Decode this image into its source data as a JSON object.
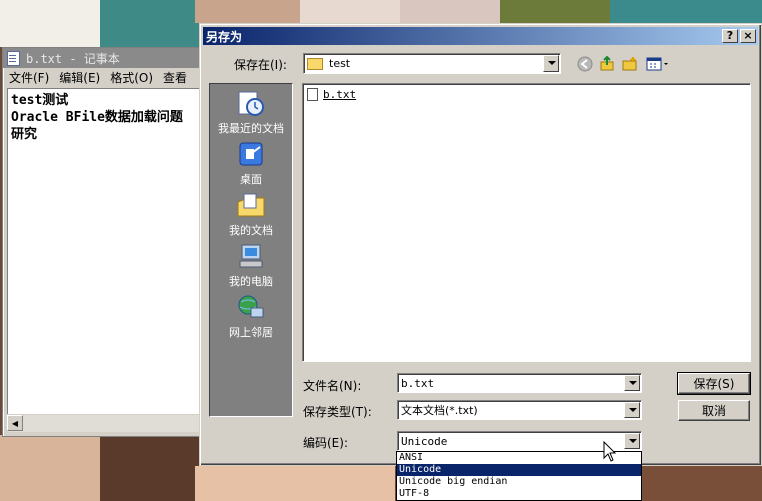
{
  "notepad": {
    "title": "b.txt - 记事本",
    "menu": [
      "文件(F)",
      "编辑(E)",
      "格式(O)",
      "查看"
    ],
    "content_lines": [
      "test测试",
      "Oracle BFile数据加载问题",
      "研究"
    ]
  },
  "dialog": {
    "title": "另存为",
    "help_label": "?",
    "close_label": "×",
    "save_in_label": "保存在(I):",
    "save_in_value": "test",
    "places": [
      {
        "label": "我最近的文档",
        "icon": "recent-documents-icon"
      },
      {
        "label": "桌面",
        "icon": "desktop-icon"
      },
      {
        "label": "我的文档",
        "icon": "my-documents-icon"
      },
      {
        "label": "我的电脑",
        "icon": "my-computer-icon"
      },
      {
        "label": "网上邻居",
        "icon": "network-places-icon"
      }
    ],
    "files": [
      {
        "name": "b.txt"
      }
    ],
    "file_name_label": "文件名(N):",
    "file_name_value": "b.txt",
    "save_type_label": "保存类型(T):",
    "save_type_value": "文本文档(*.txt)",
    "encoding_label": "编码(E):",
    "encoding_value": "Unicode",
    "encoding_options": [
      "ANSI",
      "Unicode",
      "Unicode big endian",
      "UTF-8"
    ],
    "encoding_selected_index": 1,
    "save_button": "保存(S)",
    "cancel_button": "取消"
  },
  "colors": {
    "title_active_start": "#0a246a",
    "title_active_end": "#a6caf0",
    "dialog_face": "#d4d0c8",
    "selection": "#0a246a"
  }
}
